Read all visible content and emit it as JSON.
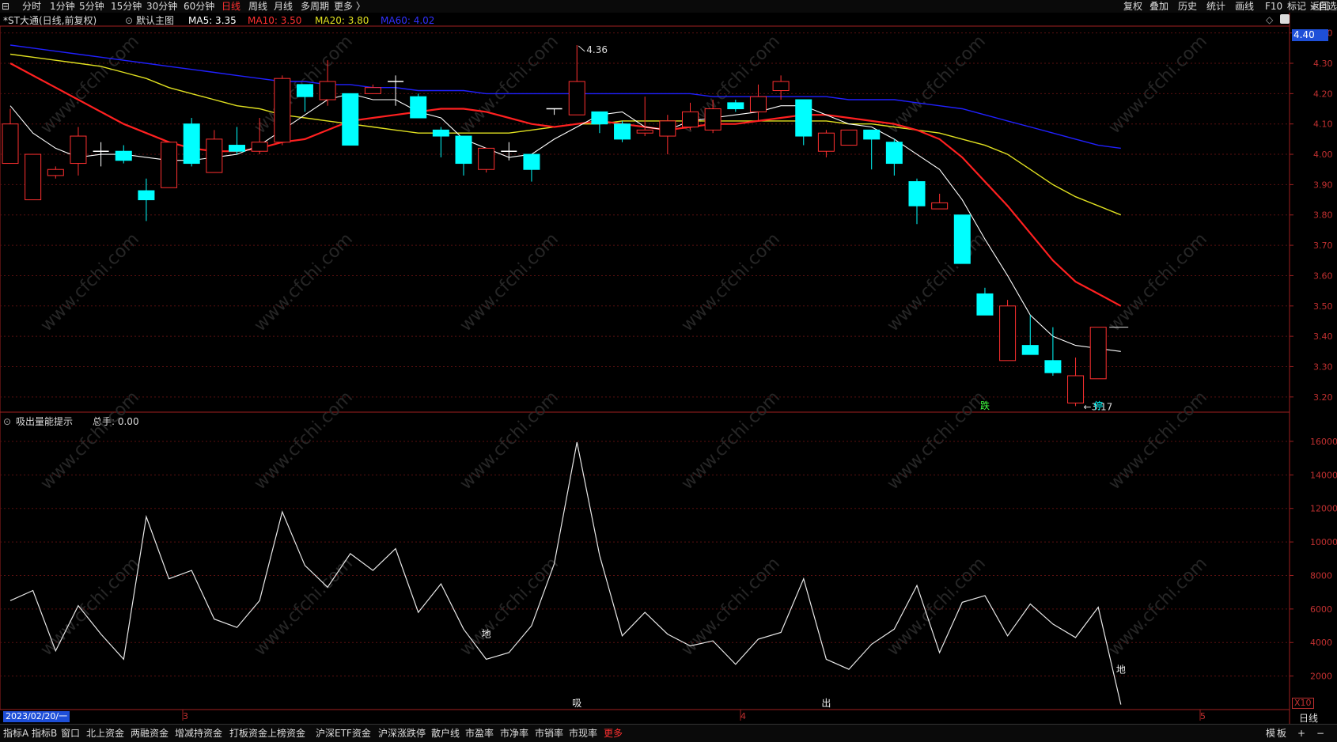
{
  "top_menu": {
    "left_icon": "⊟",
    "periods": [
      "分时",
      "1分钟",
      "5分钟",
      "15分钟",
      "30分钟",
      "60分钟",
      "日线",
      "周线",
      "月线",
      "多周期",
      "更多 〉"
    ],
    "active_period": "日线",
    "right_tools": [
      "复权",
      "叠加",
      "历史",
      "统计",
      "画线",
      "F10",
      "标记",
      "+自选",
      "返回"
    ]
  },
  "info": {
    "stock_title": "*ST大通(日线,前复权)",
    "main_chart_label": "默认主图",
    "ma5": "MA5: 3.35",
    "ma10": "MA10: 3.50",
    "ma20": "MA20: 3.80",
    "ma60": "MA60: 4.02",
    "current_price_box": "4.40",
    "colors": {
      "ma5": "#ffffff",
      "ma10": "#ff2020",
      "ma20": "#e0e020",
      "ma60": "#2020ff",
      "up": "#ff3030",
      "down": "#00ffff"
    }
  },
  "sub_info": {
    "indicator_name": "吸出量能提示",
    "total_hands": "总手: 0.00"
  },
  "bottom": {
    "date_label": "2023/02/20/一",
    "month_markers": [
      "3",
      "4",
      "5"
    ],
    "tabs": [
      "指标A",
      "指标B",
      "窗口",
      "北上资金",
      "两融资金",
      "增减持资金",
      "打板资金",
      "上榜资金",
      "沪深ETF资金",
      "沪深涨跌停",
      "散户线",
      "市盈率",
      "市净率",
      "市销率",
      "市现率",
      "更多"
    ],
    "right_controls": [
      "模",
      "板",
      "+",
      "−"
    ],
    "axis_period_label": "日线",
    "scale_box": "X10"
  },
  "chart_data": [
    {
      "type": "candlestick",
      "title": "*ST大通(日线,前复权)",
      "ylim": [
        3.15,
        4.42
      ],
      "y_ticks": [
        4.4,
        4.3,
        4.2,
        4.1,
        4.0,
        3.9,
        3.8,
        3.7,
        3.6,
        3.5,
        3.4,
        3.3,
        3.2
      ],
      "candles": [
        {
          "o": 3.97,
          "c": 4.1,
          "h": 4.15,
          "l": 3.97
        },
        {
          "o": 3.85,
          "c": 4.0,
          "h": 4.0,
          "l": 3.85
        },
        {
          "o": 3.93,
          "c": 3.95,
          "h": 3.96,
          "l": 3.92
        },
        {
          "o": 3.97,
          "c": 4.06,
          "h": 4.09,
          "l": 3.93
        },
        {
          "o": 4.01,
          "c": 4.01,
          "h": 4.04,
          "l": 3.96
        },
        {
          "o": 4.01,
          "c": 3.98,
          "h": 4.03,
          "l": 3.97
        },
        {
          "o": 3.88,
          "c": 3.85,
          "h": 3.92,
          "l": 3.78
        },
        {
          "o": 3.89,
          "c": 4.04,
          "h": 4.04,
          "l": 3.89
        },
        {
          "o": 4.1,
          "c": 3.97,
          "h": 4.12,
          "l": 3.96
        },
        {
          "o": 3.94,
          "c": 4.05,
          "h": 4.08,
          "l": 3.94
        },
        {
          "o": 4.03,
          "c": 4.01,
          "h": 4.09,
          "l": 4.0
        },
        {
          "o": 4.01,
          "c": 4.04,
          "h": 4.12,
          "l": 4.0
        },
        {
          "o": 4.04,
          "c": 4.25,
          "h": 4.26,
          "l": 4.03
        },
        {
          "o": 4.23,
          "c": 4.19,
          "h": 4.23,
          "l": 4.14
        },
        {
          "o": 4.18,
          "c": 4.24,
          "h": 4.31,
          "l": 4.16
        },
        {
          "o": 4.2,
          "c": 4.03,
          "h": 4.2,
          "l": 4.03
        },
        {
          "o": 4.2,
          "c": 4.22,
          "h": 4.23,
          "l": 4.2
        },
        {
          "o": 4.24,
          "c": 4.24,
          "h": 4.26,
          "l": 4.16
        },
        {
          "o": 4.19,
          "c": 4.12,
          "h": 4.2,
          "l": 4.12
        },
        {
          "o": 4.08,
          "c": 4.06,
          "h": 4.09,
          "l": 3.99
        },
        {
          "o": 4.06,
          "c": 3.97,
          "h": 4.06,
          "l": 3.93
        },
        {
          "o": 3.95,
          "c": 4.02,
          "h": 4.02,
          "l": 3.94
        },
        {
          "o": 4.01,
          "c": 4.01,
          "h": 4.04,
          "l": 3.98
        },
        {
          "o": 4.0,
          "c": 3.95,
          "h": 4.0,
          "l": 3.91
        },
        {
          "o": 4.15,
          "c": 4.15,
          "h": 4.15,
          "l": 4.13
        },
        {
          "o": 4.13,
          "c": 4.24,
          "h": 4.36,
          "l": 4.13
        },
        {
          "o": 4.14,
          "c": 4.1,
          "h": 4.14,
          "l": 4.07
        },
        {
          "o": 4.1,
          "c": 4.05,
          "h": 4.11,
          "l": 4.04
        },
        {
          "o": 4.07,
          "c": 4.08,
          "h": 4.19,
          "l": 4.06
        },
        {
          "o": 4.06,
          "c": 4.11,
          "h": 4.13,
          "l": 4.0
        },
        {
          "o": 4.09,
          "c": 4.14,
          "h": 4.17,
          "l": 4.08
        },
        {
          "o": 4.08,
          "c": 4.15,
          "h": 4.18,
          "l": 4.07
        },
        {
          "o": 4.17,
          "c": 4.15,
          "h": 4.18,
          "l": 4.14
        },
        {
          "o": 4.14,
          "c": 4.19,
          "h": 4.23,
          "l": 4.11
        },
        {
          "o": 4.21,
          "c": 4.24,
          "h": 4.26,
          "l": 4.18
        },
        {
          "o": 4.18,
          "c": 4.06,
          "h": 4.18,
          "l": 4.03
        },
        {
          "o": 4.01,
          "c": 4.07,
          "h": 4.08,
          "l": 3.99
        },
        {
          "o": 4.03,
          "c": 4.08,
          "h": 4.08,
          "l": 4.03
        },
        {
          "o": 4.08,
          "c": 4.05,
          "h": 4.08,
          "l": 3.95
        },
        {
          "o": 4.04,
          "c": 3.97,
          "h": 4.05,
          "l": 3.93
        },
        {
          "o": 3.91,
          "c": 3.83,
          "h": 3.92,
          "l": 3.77
        },
        {
          "o": 3.82,
          "c": 3.84,
          "h": 3.87,
          "l": 3.82
        },
        {
          "o": 3.8,
          "c": 3.64,
          "h": 3.8,
          "l": 3.64
        },
        {
          "o": 3.54,
          "c": 3.47,
          "h": 3.56,
          "l": 3.47
        },
        {
          "o": 3.32,
          "c": 3.5,
          "h": 3.52,
          "l": 3.32
        },
        {
          "o": 3.37,
          "c": 3.34,
          "h": 3.47,
          "l": 3.34
        },
        {
          "o": 3.32,
          "c": 3.28,
          "h": 3.43,
          "l": 3.27
        },
        {
          "o": 3.18,
          "c": 3.27,
          "h": 3.33,
          "l": 3.17
        },
        {
          "o": 3.26,
          "c": 3.43,
          "h": 3.43,
          "l": 3.26
        }
      ],
      "last_price_line": 3.43,
      "ma5": [
        4.16,
        4.07,
        4.02,
        3.99,
        4.0,
        4.0,
        3.99,
        3.98,
        3.98,
        3.99,
        4.0,
        4.03,
        4.08,
        4.13,
        4.18,
        4.2,
        4.18,
        4.18,
        4.14,
        4.12,
        4.05,
        4.02,
        3.99,
        4.0,
        4.05,
        4.09,
        4.13,
        4.14,
        4.09,
        4.08,
        4.11,
        4.12,
        4.13,
        4.14,
        4.16,
        4.16,
        4.13,
        4.1,
        4.09,
        4.05,
        4.0,
        3.95,
        3.85,
        3.72,
        3.6,
        3.47,
        3.4,
        3.37,
        3.36,
        3.35
      ],
      "ma10": [
        4.3,
        4.26,
        4.22,
        4.18,
        4.14,
        4.1,
        4.07,
        4.04,
        4.02,
        4.01,
        4.01,
        4.02,
        4.04,
        4.05,
        4.08,
        4.11,
        4.12,
        4.13,
        4.14,
        4.15,
        4.15,
        4.14,
        4.12,
        4.1,
        4.09,
        4.1,
        4.11,
        4.1,
        4.09,
        4.08,
        4.09,
        4.1,
        4.1,
        4.11,
        4.12,
        4.13,
        4.13,
        4.12,
        4.11,
        4.1,
        4.08,
        4.05,
        3.99,
        3.91,
        3.83,
        3.74,
        3.65,
        3.58,
        3.54,
        3.5
      ],
      "ma20": [
        4.33,
        4.32,
        4.31,
        4.3,
        4.29,
        4.27,
        4.25,
        4.22,
        4.2,
        4.18,
        4.16,
        4.15,
        4.13,
        4.12,
        4.11,
        4.1,
        4.09,
        4.08,
        4.07,
        4.07,
        4.07,
        4.07,
        4.07,
        4.08,
        4.09,
        4.1,
        4.1,
        4.11,
        4.11,
        4.11,
        4.11,
        4.11,
        4.11,
        4.11,
        4.11,
        4.11,
        4.11,
        4.1,
        4.1,
        4.09,
        4.08,
        4.07,
        4.05,
        4.03,
        4.0,
        3.95,
        3.9,
        3.86,
        3.83,
        3.8
      ],
      "ma60": [
        4.36,
        4.35,
        4.34,
        4.33,
        4.32,
        4.31,
        4.3,
        4.29,
        4.28,
        4.27,
        4.26,
        4.25,
        4.24,
        4.24,
        4.23,
        4.23,
        4.22,
        4.22,
        4.21,
        4.21,
        4.21,
        4.2,
        4.2,
        4.2,
        4.2,
        4.2,
        4.2,
        4.2,
        4.2,
        4.2,
        4.2,
        4.19,
        4.19,
        4.19,
        4.19,
        4.19,
        4.19,
        4.18,
        4.18,
        4.18,
        4.17,
        4.16,
        4.15,
        4.13,
        4.11,
        4.09,
        4.07,
        4.05,
        4.03,
        4.02
      ],
      "annotations": [
        {
          "label": "4.36",
          "index": 25,
          "value": 4.36,
          "kind": "high"
        },
        {
          "label": "3.17",
          "index": 47,
          "value": 3.17,
          "kind": "low"
        },
        {
          "label": "跌",
          "index": 43,
          "color": "#40ff40"
        },
        {
          "label": "停",
          "index": 48,
          "color": "#00ffff"
        }
      ]
    },
    {
      "type": "line",
      "title": "吸出量能提示",
      "ylim": [
        0,
        16800
      ],
      "y_ticks": [
        2000,
        4000,
        6000,
        8000,
        10000,
        12000,
        14000,
        16000
      ],
      "values": [
        6500,
        7100,
        3500,
        6200,
        4500,
        3000,
        11500,
        7800,
        8300,
        5400,
        4900,
        6500,
        11800,
        8600,
        7300,
        9300,
        8300,
        9600,
        5800,
        7500,
        4800,
        3000,
        3400,
        5000,
        8700,
        15950,
        9200,
        4400,
        5800,
        4500,
        3800,
        4100,
        2700,
        4200,
        4600,
        7800,
        3000,
        2400,
        3900,
        4800,
        7400,
        3400,
        6400,
        6800,
        4400,
        6300,
        5100,
        4300,
        6100,
        300
      ],
      "annotations": [
        {
          "label": "地",
          "index": 21
        },
        {
          "label": "吸",
          "index": 25
        },
        {
          "label": "出",
          "index": 36
        },
        {
          "label": "地",
          "index": 49
        }
      ]
    }
  ]
}
